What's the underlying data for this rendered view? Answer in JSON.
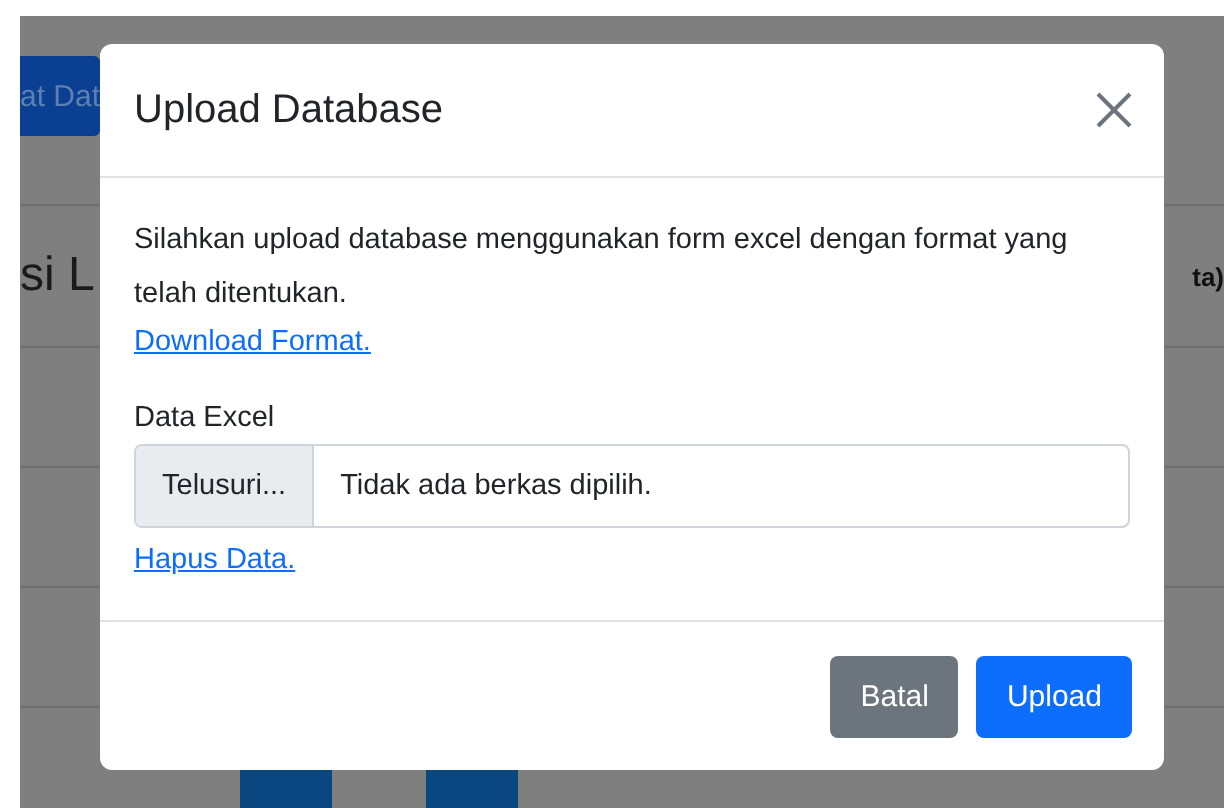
{
  "background": {
    "top_button": "at Dat",
    "heading": "si L",
    "column_header": "ta)"
  },
  "modal": {
    "title": "Upload Database",
    "description": "Silahkan upload database menggunakan form excel dengan format yang telah ditentukan.",
    "download_link": "Download Format.",
    "field_label": "Data Excel",
    "browse_button": "Telusuri...",
    "file_status": "Tidak ada berkas dipilih.",
    "delete_link": "Hapus Data.",
    "buttons": [
      {
        "label": "Batal",
        "kind": "secondary"
      },
      {
        "label": "Upload",
        "kind": "primary"
      }
    ]
  }
}
